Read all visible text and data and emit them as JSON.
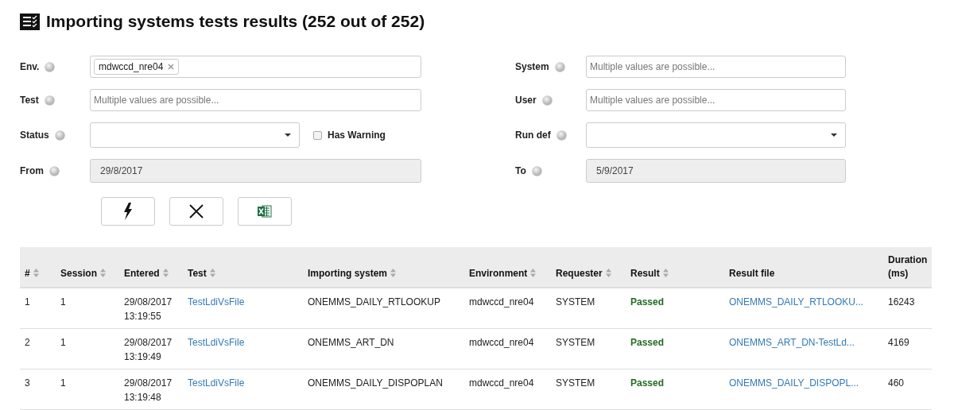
{
  "title": "Importing systems tests results (252 out of 252)",
  "filters_left": [
    {
      "label": "Env.",
      "kind": "tags",
      "tags": [
        "mdwccd_nre04"
      ]
    },
    {
      "label": "Test",
      "kind": "text",
      "placeholder": "Multiple values are possible..."
    },
    {
      "label": "Status",
      "kind": "select",
      "checkbox": {
        "label": "Has Warning",
        "checked": false
      }
    },
    {
      "label": "From",
      "kind": "date",
      "value": "29/8/2017"
    }
  ],
  "filters_right": [
    {
      "label": "System",
      "kind": "text",
      "placeholder": "Multiple values are possible..."
    },
    {
      "label": "User",
      "kind": "text",
      "placeholder": "Multiple values are possible..."
    },
    {
      "label": "Run def",
      "kind": "select"
    },
    {
      "label": "To",
      "kind": "date",
      "value": "5/9/2017"
    }
  ],
  "buttons": [
    {
      "kind": "run"
    },
    {
      "kind": "clear"
    },
    {
      "kind": "excel"
    }
  ],
  "table": {
    "columns": [
      {
        "label": "#",
        "sortable": true,
        "kind": "text"
      },
      {
        "label": "Session",
        "sortable": true,
        "kind": "text"
      },
      {
        "label": "Entered",
        "sortable": true,
        "kind": "text"
      },
      {
        "label": "Test",
        "sortable": true,
        "kind": "link"
      },
      {
        "label": "Importing system",
        "sortable": true,
        "kind": "text"
      },
      {
        "label": "Environment",
        "sortable": true,
        "kind": "text"
      },
      {
        "label": "Requester",
        "sortable": true,
        "kind": "text"
      },
      {
        "label": "Result",
        "sortable": true,
        "kind": "status"
      },
      {
        "label": "Result file",
        "sortable": false,
        "kind": "link"
      },
      {
        "label": "Duration (ms)",
        "sortable": false,
        "kind": "text"
      }
    ],
    "rows": [
      [
        "1",
        "1",
        "29/08/2017 13:19:55",
        "TestLdiVsFile",
        "ONEMMS_DAILY_RTLOOKUP",
        "mdwccd_nre04",
        "SYSTEM",
        "Passed",
        "ONEMMS_DAILY_RTLOOKU...",
        "16243"
      ],
      [
        "2",
        "1",
        "29/08/2017 13:19:49",
        "TestLdiVsFile",
        "ONEMMS_ART_DN",
        "mdwccd_nre04",
        "SYSTEM",
        "Passed",
        "ONEMMS_ART_DN-TestLd...",
        "4169"
      ],
      [
        "3",
        "1",
        "29/08/2017 13:19:48",
        "TestLdiVsFile",
        "ONEMMS_DAILY_DISPOPLAN",
        "mdwccd_nre04",
        "SYSTEM",
        "Passed",
        "ONEMMS_DAILY_DISPOPL...",
        "460"
      ]
    ]
  }
}
